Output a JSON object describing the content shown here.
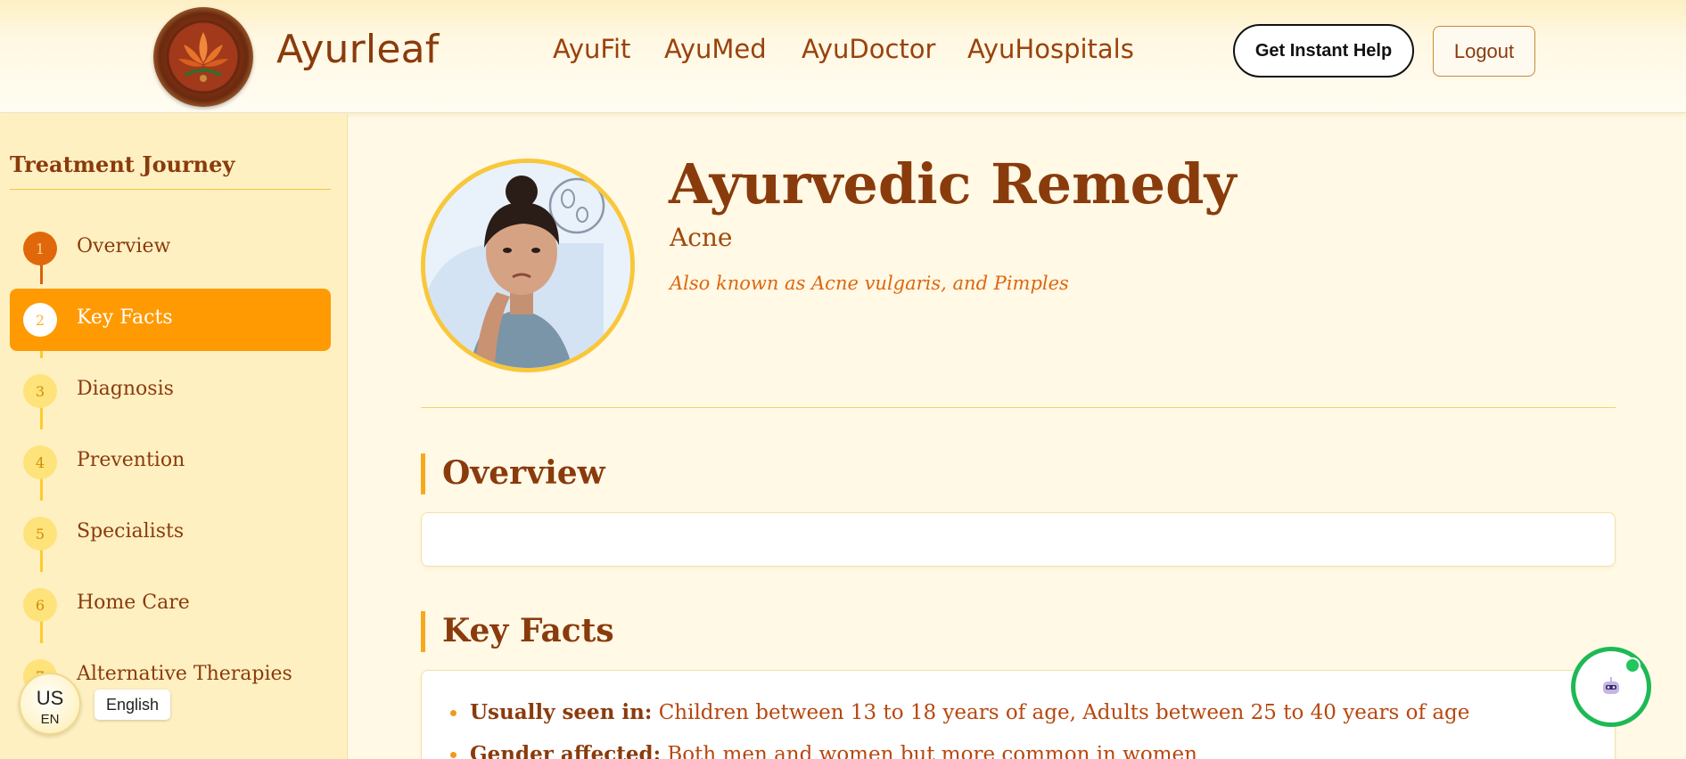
{
  "header": {
    "brand": "Ayurleaf",
    "nav": [
      "AyuFit",
      "AyuMed",
      "AyuDoctor",
      "AyuHospitals"
    ],
    "help_button": "Get Instant Help",
    "logout_button": "Logout"
  },
  "sidebar": {
    "title": "Treatment Journey",
    "steps": [
      {
        "num": "1",
        "label": "Overview"
      },
      {
        "num": "2",
        "label": "Key Facts"
      },
      {
        "num": "3",
        "label": "Diagnosis"
      },
      {
        "num": "4",
        "label": "Prevention"
      },
      {
        "num": "5",
        "label": "Specialists"
      },
      {
        "num": "6",
        "label": "Home Care"
      },
      {
        "num": "7",
        "label": "Alternative Therapies"
      }
    ],
    "active_step": "Key Facts"
  },
  "language": {
    "code": "US",
    "sub": "EN",
    "name": "English"
  },
  "hero": {
    "title": "Ayurvedic Remedy",
    "condition": "Acne",
    "aka": "Also known as Acne vulgaris, and Pimples"
  },
  "sections": {
    "overview_title": "Overview",
    "keyfacts_title": "Key Facts",
    "facts": [
      {
        "label": "Usually seen in:",
        "value": "Children between 13 to 18 years of age, Adults between 25 to 40 years of age"
      },
      {
        "label": "Gender affected:",
        "value": "Both men and women but more common in women"
      }
    ]
  },
  "colors": {
    "brand_brown": "#8a3b0c",
    "accent_orange": "#ff9a02",
    "chat_green": "#1db954"
  }
}
